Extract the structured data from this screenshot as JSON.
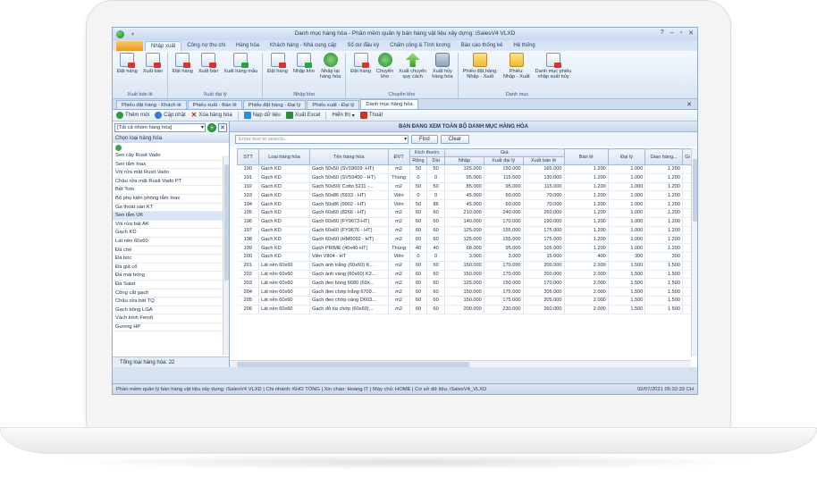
{
  "window": {
    "title": "Danh mục hàng hóa - Phần mềm quản lý bán hàng vật liệu xây dựng: iSalesV4 VLXD",
    "controls": [
      "?",
      "–",
      "▫",
      "✕"
    ]
  },
  "menu": {
    "items": [
      "Nhập xuất",
      "Công nợ thu chi",
      "Hàng hóa",
      "Khách hàng - Nhà cung cấp",
      "Sổ dư đầu kỳ",
      "Chấm công & Tính lương",
      "Báo cáo thống kê",
      "Hệ thống"
    ]
  },
  "ribbon": {
    "groups": [
      {
        "label": "Xuất bán lẻ",
        "buttons": [
          {
            "label": "Đặt hàng",
            "icon": "document-icon"
          },
          {
            "label": "Xuất bán",
            "icon": "document-export-icon"
          }
        ]
      },
      {
        "label": "Xuất đại lý",
        "buttons": [
          {
            "label": "Đặt hàng",
            "icon": "document-icon"
          },
          {
            "label": "Xuất bán",
            "icon": "document-export-icon"
          },
          {
            "label": "Xuất hàng mẫu",
            "icon": "sample-icon"
          }
        ]
      },
      {
        "label": "Nhập kho",
        "buttons": [
          {
            "label": "Đặt hàng",
            "icon": "document-icon"
          },
          {
            "label": "Nhập kho",
            "icon": "import-icon"
          },
          {
            "label": "Nhập lại\nhàng hóa",
            "icon": "return-icon"
          }
        ]
      },
      {
        "label": "Chuyển kho",
        "buttons": [
          {
            "label": "Đặt hàng",
            "icon": "document-icon"
          },
          {
            "label": "Chuyển\nkho",
            "icon": "transfer-icon"
          },
          {
            "label": "Xuất chuyển\nquy cách",
            "icon": "convert-icon"
          },
          {
            "label": "Xuất hủy\nhàng hóa",
            "icon": "trash-icon"
          }
        ]
      },
      {
        "label": "Danh mục",
        "buttons": [
          {
            "label": "Phiếu đặt hàng:\nNhập - Xuất",
            "icon": "folder-icon"
          },
          {
            "label": "Phiếu:\nNhập - Xuất",
            "icon": "folder-icon"
          },
          {
            "label": "Danh mục phiếu\nnhập xuất hủy",
            "icon": "cancel-doc-icon"
          }
        ]
      }
    ]
  },
  "doc_tabs": [
    "Phiếu đặt hàng - Khách lẻ",
    "Phiếu xuất - Bán lẻ",
    "Phiếu đặt hàng - Đại lý",
    "Phiếu xuất - Đại lý",
    "Danh mục hàng hóa"
  ],
  "toolbar": {
    "add": "Thêm mới",
    "update": "Cập nhật",
    "delete": "Xóa hàng hóa",
    "import": "Nạp dữ liệu",
    "export": "Xuất Excel",
    "view": "Hiển thị",
    "exit": "Thoát"
  },
  "left_panel": {
    "filter_value": "[Tất cả nhóm hàng hóa]",
    "header": "Chọn loại hàng hóa",
    "items": [
      "Sen cây Rusit Vado",
      "Sen tắm Inax",
      "Vòi rửa mặt Rusit Vado",
      "Chậu rửa mặt Rusit Vado PT",
      "Bệt Toto",
      "Bộ phụ kiện phòng tắm Inax",
      "Ga thoát sàn KT",
      "Sen tắm UK",
      "Vòi rửa bát AK",
      "Gạch KD",
      "Lát nền 60x60",
      "Đá chẻ",
      "Đá bóc",
      "Đá giả cổ",
      "Đá mài bóng",
      "Đá Salat",
      "Công cắt gạch",
      "Chậu rửa bát TQ",
      "Gạch bông LGA",
      "Vách kính Fendi",
      "Gương HP"
    ],
    "selected_index": 7,
    "footer": "Tổng loại hàng hóa: 22"
  },
  "main": {
    "title": "BẠN ĐANG XEM TOÀN BỘ DANH MỤC HÀNG HÓA",
    "search_placeholder": "Enter text to search...",
    "find": "Find",
    "clear": "Clear",
    "header_groups": {
      "size": "Kích thước",
      "price": "Giá"
    },
    "columns": [
      "STT",
      "Loại hàng hóa",
      "Tên hàng hóa",
      "ĐVT",
      "Rộng",
      "Dài",
      "Nhập",
      "Xuất đại lý",
      "Xuất bán lẻ",
      "Bán lẻ",
      "Đại lý",
      "Giao hàng...",
      "Gi"
    ],
    "rows": [
      [
        "190",
        "Gạch KD",
        "Gạch 50x50 (SV18609 -HT)",
        "m2",
        "50",
        "50",
        "125.000",
        "150.000",
        "165.000",
        "1.200",
        "1.000",
        "1.200",
        ""
      ],
      [
        "191",
        "Gạch KD",
        "Gạch 50x50 (SV59400 - HT)",
        "Thùng",
        "0",
        "0",
        "95.000",
        "115.000",
        "130.000",
        "1.200",
        "1.000",
        "1.200",
        ""
      ],
      [
        "192",
        "Gạch KD",
        "Gạch 50x50( Cotto 5211 -...",
        "m2",
        "50",
        "50",
        "85.000",
        "95.000",
        "115.000",
        "1.200",
        "1.000",
        "1.200",
        ""
      ],
      [
        "193",
        "Gạch KD",
        "Gạch 50x86 (5933 - HT)",
        "Viên",
        "0",
        "0",
        "45.000",
        "60.000",
        "70.000",
        "1.200",
        "1.000",
        "1.200",
        ""
      ],
      [
        "194",
        "Gạch KD",
        "Gạch 50x86 (9902 - HT)",
        "Viên",
        "50",
        "86",
        "45.000",
        "60.000",
        "70.000",
        "1.200",
        "1.000",
        "1.200",
        ""
      ],
      [
        "195",
        "Gạch KD",
        "Gạch 60x60 (8266 - HT)",
        "m2",
        "60",
        "60",
        "210.000",
        "240.000",
        "260.000",
        "1.200",
        "1.000",
        "1.200",
        ""
      ],
      [
        "196",
        "Gạch KD",
        "Gạch 60x60 (FY9673-HT)",
        "m2",
        "60",
        "60",
        "140.000",
        "170.000",
        "190.000",
        "1.200",
        "1.000",
        "1.200",
        ""
      ],
      [
        "197",
        "Gạch KD",
        "Gạch 60x60 (FY9676 - HT)",
        "m2",
        "60",
        "60",
        "125.000",
        "155.000",
        "175.000",
        "1.200",
        "1.000",
        "1.200",
        ""
      ],
      [
        "198",
        "Gạch KD",
        "Gạch 60x60 (HM6092 - HT)",
        "m2",
        "60",
        "60",
        "125.000",
        "155.000",
        "175.000",
        "1.200",
        "1.000",
        "1.200",
        ""
      ],
      [
        "199",
        "Gạch KD",
        "Gạch PRIME (40x40-HT)",
        "Thùng",
        "40",
        "40",
        "68.000",
        "95.000",
        "105.000",
        "1.200",
        "1.000",
        "1.200",
        ""
      ],
      [
        "200",
        "Gạch KD",
        "Viên V804 - HT",
        "Viên",
        "0",
        "0",
        "3.000",
        "3.000",
        "15.000",
        "400",
        "300",
        "300",
        ""
      ],
      [
        "201",
        "Lát nền 60x60",
        "Gạch ánh trắng (60x60) K...",
        "m2",
        "60",
        "60",
        "150.000",
        "170.000",
        "200.000",
        "2.000",
        "1.500",
        "1.500",
        ""
      ],
      [
        "202",
        "Lát nền 60x60",
        "Gạch ánh vàng (60x60) K2...",
        "m2",
        "60",
        "60",
        "150.000",
        "170.000",
        "200.000",
        "2.000",
        "1.500",
        "1.500",
        ""
      ],
      [
        "203",
        "Lát nền 60x60",
        "Gạch đen bóng 6680 (60x...",
        "m2",
        "60",
        "60",
        "125.000",
        "150.000",
        "170.000",
        "2.000",
        "1.500",
        "1.500",
        ""
      ],
      [
        "204",
        "Lát nền 60x60",
        "Gạch đen chớp trắng 6709...",
        "m2",
        "60",
        "60",
        "150.000",
        "175.000",
        "205.000",
        "2.000",
        "1.500",
        "1.500",
        ""
      ],
      [
        "205",
        "Lát nền 60x60",
        "Gạch đen chớp vàng D603...",
        "m2",
        "60",
        "60",
        "150.000",
        "175.000",
        "205.000",
        "2.000",
        "1.500",
        "1.500",
        ""
      ],
      [
        "206",
        "Lát nền 60x60",
        "Gạch đỏ tía chớp (60x60)...",
        "m2",
        "60",
        "60",
        "200.000",
        "230.000",
        "260.000",
        "2.000",
        "1.500",
        "1.500",
        ""
      ]
    ]
  },
  "status": {
    "text": "Phần mềm quản lý bán hàng vật liệu xây dựng: iSalesV4 VLXD  |  Chi nhánh: KHO TỔNG  |  Xin chào: Hoàng IT  |  Máy chủ: HOME  |  Cơ sở dữ liệu: iSalesV4_VLXD",
    "datetime": "02/07/2021 05:32:33 CH"
  }
}
